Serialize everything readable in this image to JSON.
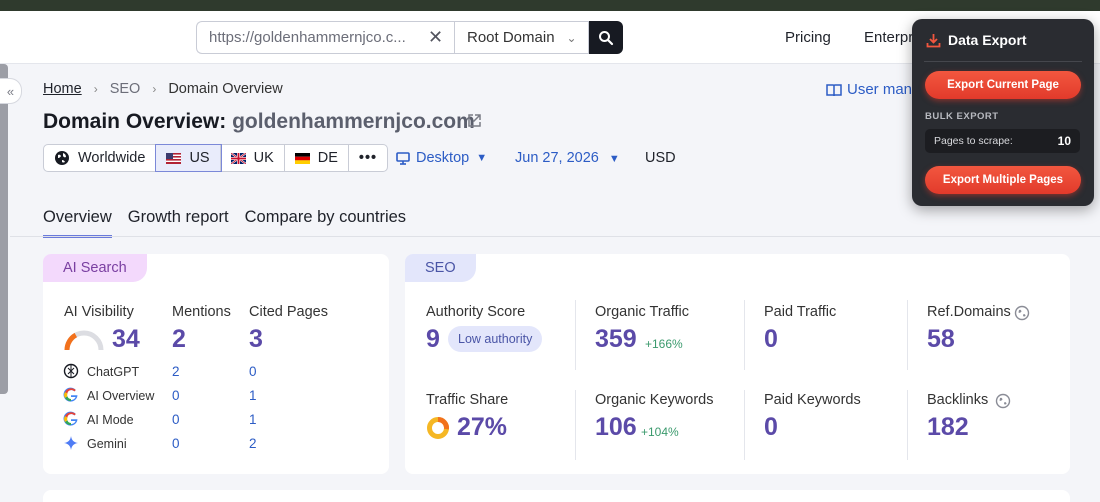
{
  "header": {
    "search_value": "https://goldenhammernjco.c...",
    "scope_label": "Root Domain",
    "nav": [
      "Pricing",
      "Enterpr"
    ]
  },
  "breadcrumb": {
    "home": "Home",
    "section": "SEO",
    "current": "Domain Overview"
  },
  "user_manual": "User manu",
  "title": {
    "prefix": "Domain Overview:",
    "domain": "goldenhammernjco.com"
  },
  "databases": {
    "worldwide": "Worldwide",
    "us": "US",
    "uk": "UK",
    "de": "DE",
    "more": "•••"
  },
  "filters": {
    "device": "Desktop",
    "date": "Jun 27, 2026",
    "currency": "USD"
  },
  "tabs": [
    "Overview",
    "Growth report",
    "Compare by countries"
  ],
  "ai_card": {
    "tag": "AI Search",
    "col_labels": [
      "AI Visibility",
      "Mentions",
      "Cited Pages"
    ],
    "visibility": "34",
    "mentions": "2",
    "cited_pages": "3",
    "rows": [
      {
        "name": "ChatGPT",
        "mentions": "2",
        "cited": "0"
      },
      {
        "name": "AI Overview",
        "mentions": "0",
        "cited": "1"
      },
      {
        "name": "AI Mode",
        "mentions": "0",
        "cited": "1"
      },
      {
        "name": "Gemini",
        "mentions": "0",
        "cited": "2"
      }
    ]
  },
  "seo_card": {
    "tag": "SEO",
    "authority_label": "Authority Score",
    "authority_value": "9",
    "authority_badge": "Low authority",
    "organic_traffic_label": "Organic Traffic",
    "organic_traffic_value": "359",
    "organic_traffic_delta": "+166%",
    "paid_traffic_label": "Paid Traffic",
    "paid_traffic_value": "0",
    "ref_domains_label": "Ref.Domains",
    "ref_domains_value": "58",
    "traffic_share_label": "Traffic Share",
    "traffic_share_value": "27%",
    "traffic_share_fraction": 0.27,
    "organic_keywords_label": "Organic Keywords",
    "organic_keywords_value": "106",
    "organic_keywords_delta": "+104%",
    "paid_keywords_label": "Paid Keywords",
    "paid_keywords_value": "0",
    "backlinks_label": "Backlinks",
    "backlinks_value": "182"
  },
  "export_panel": {
    "title": "Data Export",
    "export_current": "Export Current Page",
    "bulk_label": "BULK EXPORT",
    "pages_label": "Pages to scrape:",
    "pages_value": "10",
    "export_multiple": "Export Multiple Pages"
  },
  "colors": {
    "accent": "#5b4aa8",
    "link": "#2c5cc5",
    "export_button": "#e23a2b",
    "positive": "#3b9a6d"
  }
}
